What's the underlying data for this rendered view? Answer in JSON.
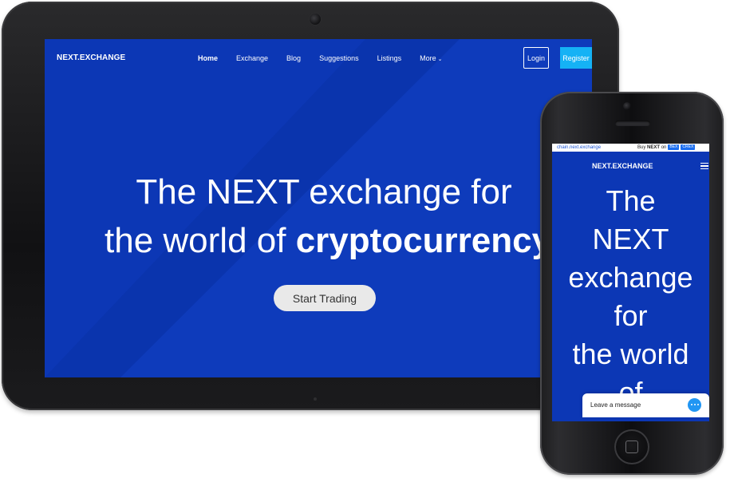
{
  "tablet": {
    "brand": "NEXT.EXCHANGE",
    "nav": {
      "home": "Home",
      "exchange": "Exchange",
      "blog": "Blog",
      "suggestions": "Suggestions",
      "listings": "Listings",
      "more": "More"
    },
    "login_label": "Login",
    "register_label": "Register",
    "hero": {
      "line1": "The NEXT exchange for",
      "line2_prefix": "the world of ",
      "line2_bold": "cryptocurrency"
    },
    "cta_label": "Start Trading"
  },
  "phone": {
    "ticker_left": "chain.next.exchange",
    "ticker_right_prefix": "Buy ",
    "ticker_right_bold": "NEXT",
    "ticker_right_suffix": " on",
    "badge1": "BEX",
    "badge2": "CREX",
    "brand": "NEXT.EXCHANGE",
    "hero_lines": [
      "The",
      "NEXT",
      "exchange",
      "for",
      "the world",
      "of"
    ],
    "chat_label": "Leave a message"
  },
  "colors": {
    "background_blue": "#0c37b5",
    "register_blue": "#15b2f5",
    "chat_blue": "#2196f3"
  },
  "icons": {
    "more_chevron": "chevron-down-icon",
    "phone_menu": "hamburger-menu-icon",
    "chat": "chat-bubble-icon"
  }
}
